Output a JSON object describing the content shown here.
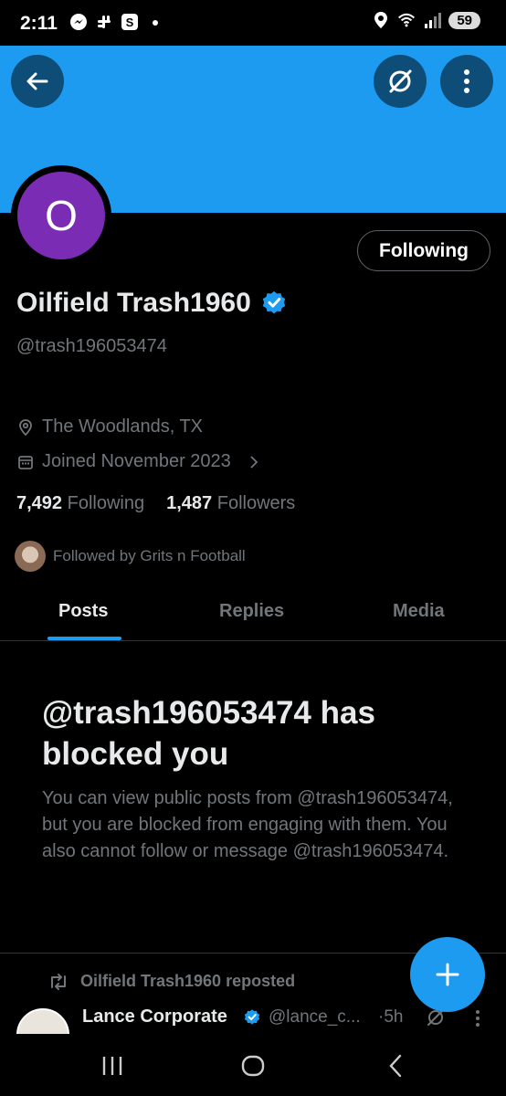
{
  "status_bar": {
    "time": "2:11",
    "battery": "59",
    "icons": [
      "messenger-icon",
      "slack-icon",
      "s-app-icon",
      "dot-icon",
      "location-icon",
      "wifi-icon",
      "signal-icon",
      "battery-icon"
    ]
  },
  "header": {
    "banner_color": "#1d9bf0",
    "back_icon": "arrow-left-icon",
    "grok_icon": "grok-icon",
    "more_icon": "more-vertical-icon"
  },
  "profile": {
    "avatar_letter": "O",
    "avatar_color": "#7b2cb5",
    "following_button": "Following",
    "display_name": "Oilfield Trash1960",
    "handle": "@trash196053474",
    "location": "The Woodlands, TX",
    "joined": "Joined November 2023",
    "following_count": "7,492",
    "following_label": "Following",
    "followers_count": "1,487",
    "followers_label": "Followers",
    "followed_by": "Followed by Grits n Football"
  },
  "tabs": [
    {
      "label": "Posts",
      "active": true
    },
    {
      "label": "Replies",
      "active": false
    },
    {
      "label": "Media",
      "active": false
    }
  ],
  "blocked": {
    "title": "@trash196053474 has blocked you",
    "body": "You can view public posts from @trash196053474, but you are blocked from engaging with them. You also cannot follow or message @trash196053474."
  },
  "post": {
    "repost_label": "Oilfield Trash1960 reposted",
    "author_name": "Lance Corporate",
    "author_handle": "@lance_c...",
    "time": "·5h"
  },
  "fab": {
    "icon": "plus-icon"
  },
  "accent_color": "#1d9bf0"
}
